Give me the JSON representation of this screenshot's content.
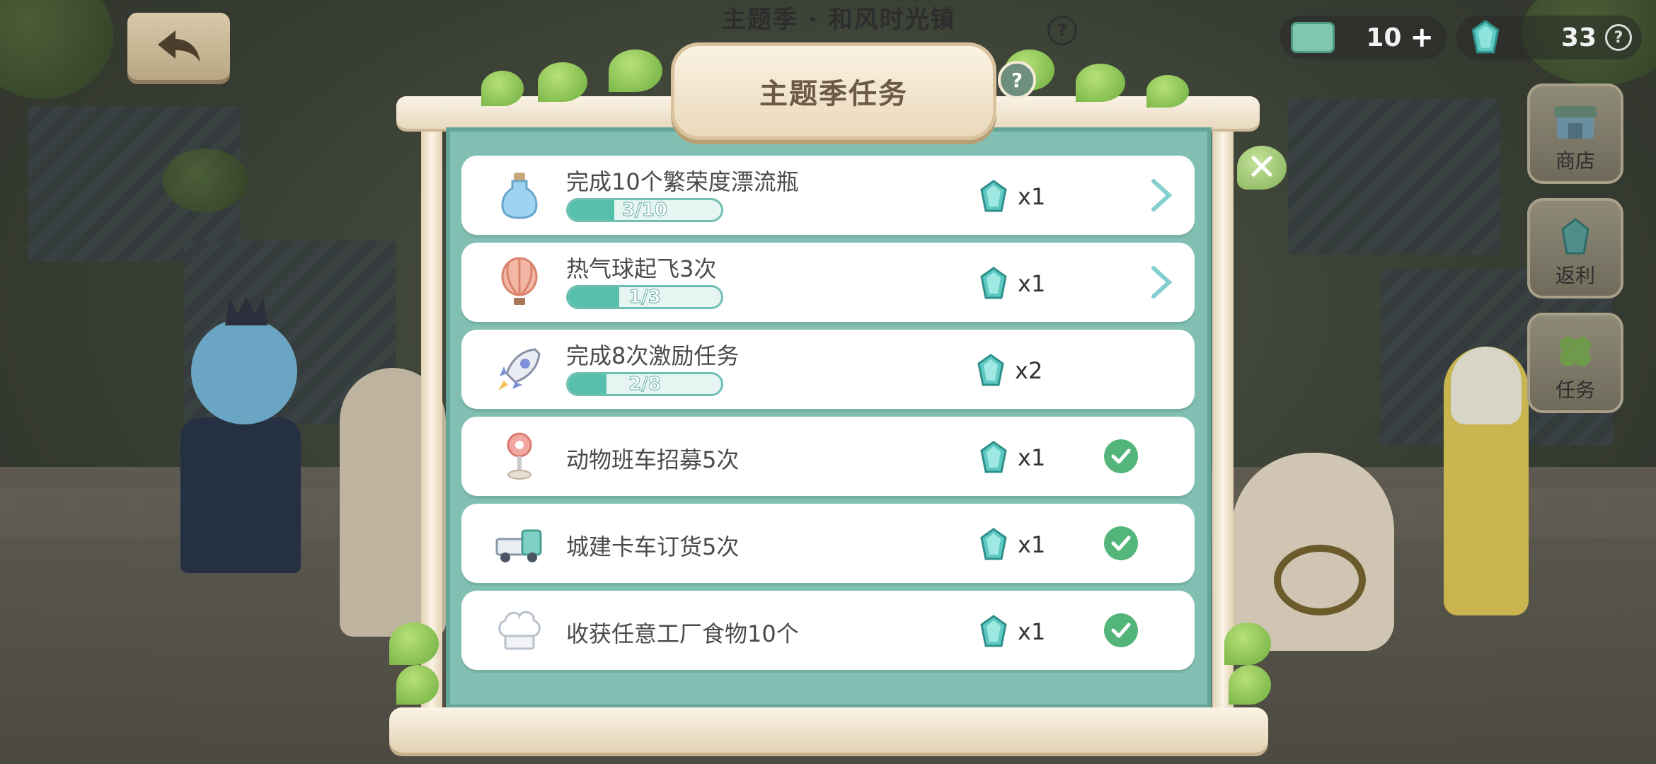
{
  "header": {
    "season_title": "主题季 · 和风时光镇",
    "cash_amount": "10",
    "gem_amount": "33"
  },
  "side_menu": [
    {
      "label": "商店",
      "icon": "shop-icon"
    },
    {
      "label": "返利",
      "icon": "gem-icon"
    },
    {
      "label": "任务",
      "icon": "clover-icon"
    }
  ],
  "dialog": {
    "title": "主题季任务",
    "tasks": [
      {
        "name": "完成10个繁荣度漂流瓶",
        "progress_text": "3/10",
        "progress": 0.3,
        "reward": "x1",
        "status": "go",
        "icon": "bottle-icon"
      },
      {
        "name": "热气球起飞3次",
        "progress_text": "1/3",
        "progress": 0.333,
        "reward": "x1",
        "status": "go",
        "icon": "hot-air-balloon-icon"
      },
      {
        "name": "完成8次激励任务",
        "progress_text": "2/8",
        "progress": 0.25,
        "reward": "x2",
        "status": "pending",
        "icon": "rocket-icon"
      },
      {
        "name": "动物班车招募5次",
        "reward": "x1",
        "status": "done",
        "icon": "bus-stop-sign-icon"
      },
      {
        "name": "城建卡车订货5次",
        "reward": "x1",
        "status": "done",
        "icon": "truck-icon"
      },
      {
        "name": "收获任意工厂食物10个",
        "reward": "x1",
        "status": "done",
        "icon": "chef-hat-icon"
      }
    ]
  },
  "colors": {
    "panel": "#81bfb3",
    "progress_fill": "#56c0ad",
    "check": "#54b57a",
    "gem": "#5ec9c2"
  }
}
